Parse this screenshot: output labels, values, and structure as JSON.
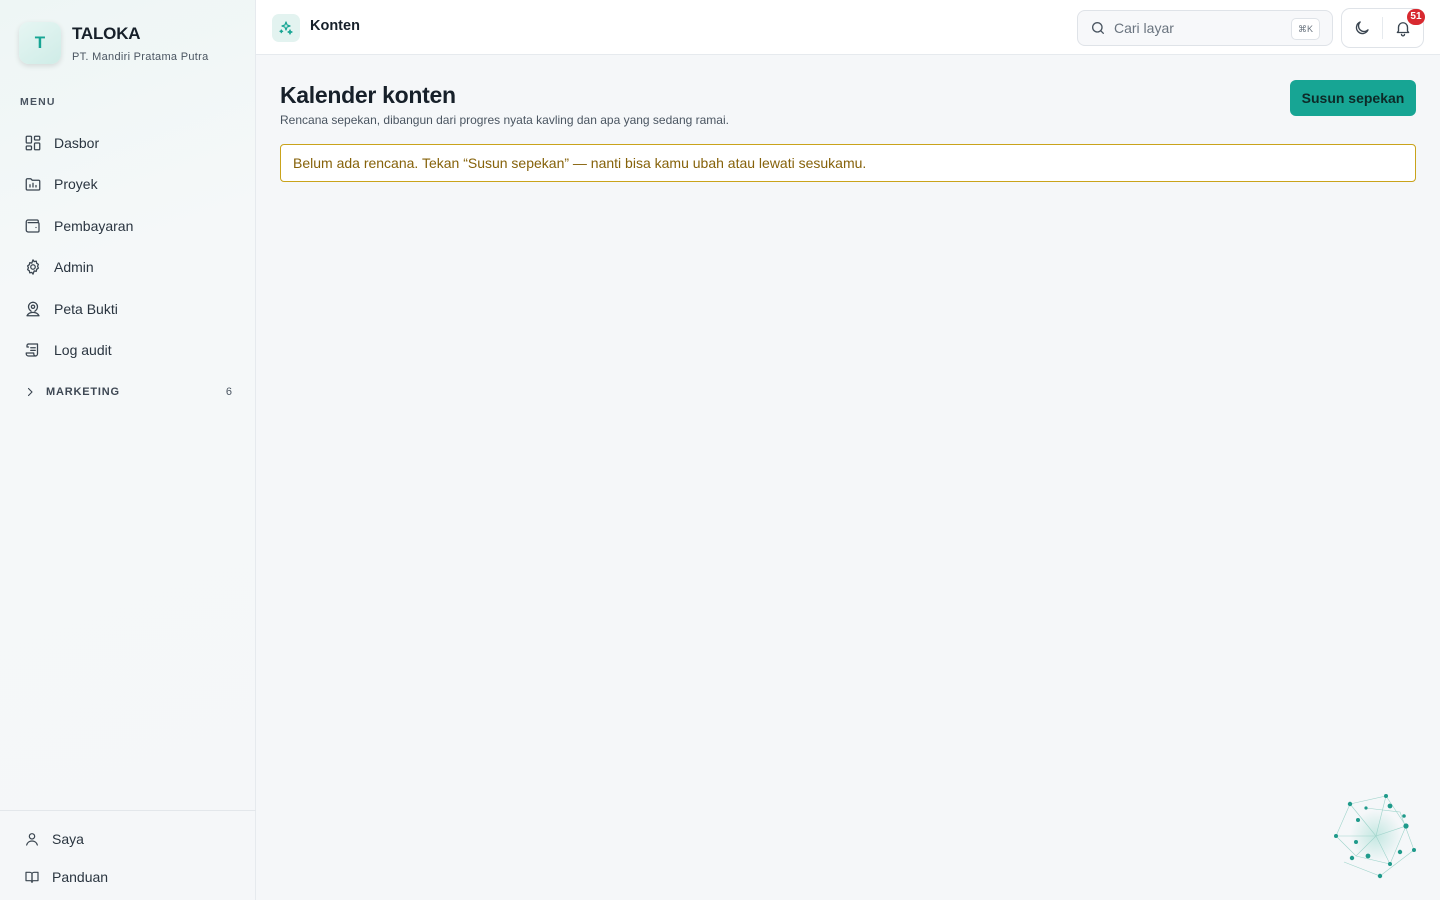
{
  "brand": {
    "logo_letter": "T",
    "name": "TALOKA",
    "org": "PT. Mandiri Pratama Putra"
  },
  "sidebar": {
    "menu_label": "MENU",
    "items": [
      {
        "label": "Dasbor",
        "icon": "dashboard-icon"
      },
      {
        "label": "Proyek",
        "icon": "folder-chart-icon"
      },
      {
        "label": "Pembayaran",
        "icon": "wallet-icon"
      },
      {
        "label": "Admin",
        "icon": "gear-icon"
      },
      {
        "label": "Peta Bukti",
        "icon": "map-pin-user-icon"
      },
      {
        "label": "Log audit",
        "icon": "scroll-icon"
      }
    ],
    "group": {
      "label": "MARKETING",
      "count": "6",
      "icon": "chevron-right-icon"
    },
    "bottom": [
      {
        "label": "Saya",
        "icon": "user-icon"
      },
      {
        "label": "Panduan",
        "icon": "book-icon"
      }
    ]
  },
  "topbar": {
    "title": "Konten",
    "icon": "sparkles-icon",
    "search_placeholder": "Cari layar",
    "search_shortcut": "⌘K",
    "notification_count": "51"
  },
  "main": {
    "title": "Kalender konten",
    "subtitle": "Rencana sepekan, dibangun dari progres nyata kavling dan apa yang sedang ramai.",
    "primary_button": "Susun sepekan",
    "notice": "Belum ada rencana. Tekan “Susun sepekan” — nanti bisa kamu ubah atau lewati sesukamu."
  },
  "colors": {
    "accent": "#17a594",
    "notice_border": "#c9a31b",
    "notice_text": "#86620a",
    "badge": "#d8292f"
  }
}
